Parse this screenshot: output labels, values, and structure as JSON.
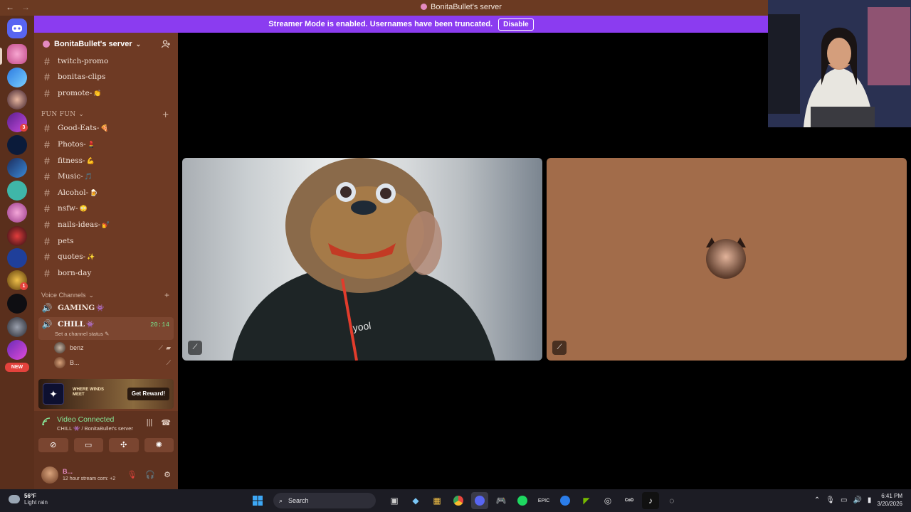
{
  "window": {
    "title": "BonitaBullet's server"
  },
  "banner": {
    "message": "Streamer Mode is enabled. Usernames have been truncated.",
    "disable_label": "Disable"
  },
  "server": {
    "name": "BonitaBullet's server"
  },
  "text_channels": [
    {
      "name": "twitch-promo",
      "emoji": ""
    },
    {
      "name": "bonitas-clips",
      "emoji": ""
    },
    {
      "name": "promote-",
      "emoji": "👏"
    }
  ],
  "fun_category": "FUN FUN",
  "fun_channels": [
    {
      "name": "Good-Eats-",
      "emoji": "🍕"
    },
    {
      "name": "Photos-",
      "emoji": "💄"
    },
    {
      "name": "fitness-",
      "emoji": "💪"
    },
    {
      "name": "Music-",
      "emoji": "🎵"
    },
    {
      "name": "Alcohol-",
      "emoji": "🍺"
    },
    {
      "name": "nsfw-",
      "emoji": "😳"
    },
    {
      "name": "nails-ideas-",
      "emoji": "💅"
    },
    {
      "name": "pets",
      "emoji": ""
    },
    {
      "name": "quotes-",
      "emoji": "✨"
    },
    {
      "name": "born-day",
      "emoji": ""
    }
  ],
  "voice_category": "Voice Channels",
  "voice_channels": [
    {
      "name": "GAMING",
      "emoji": "👾"
    },
    {
      "name": "CHILL",
      "emoji": "👾",
      "timer": "20:14",
      "status": "Set a channel status"
    }
  ],
  "voice_users": [
    {
      "name": "benz"
    },
    {
      "name": "B..."
    }
  ],
  "rail": {
    "new_label": "NEW",
    "badges": [
      "3",
      "1"
    ]
  },
  "promo": {
    "logo_text": "WHERE WINDS MEET",
    "button_label": "Get Reward!"
  },
  "voice_panel": {
    "status": "Video Connected",
    "channel": "CHILL",
    "server": "/ BonitaBullet's server"
  },
  "user": {
    "name": "B...",
    "status": "12 hour stream com: +2"
  },
  "taskbar": {
    "temperature": "56°F",
    "weather": "Light rain",
    "search_placeholder": "Search",
    "time": "6:41 PM",
    "date": "3/20/2026"
  },
  "colors": {
    "sidebar": "#6e3a24",
    "rail": "#5a2f1c",
    "banner": "#8b3cf0",
    "connected": "#86e596",
    "tile_background": "#a26c4a"
  }
}
